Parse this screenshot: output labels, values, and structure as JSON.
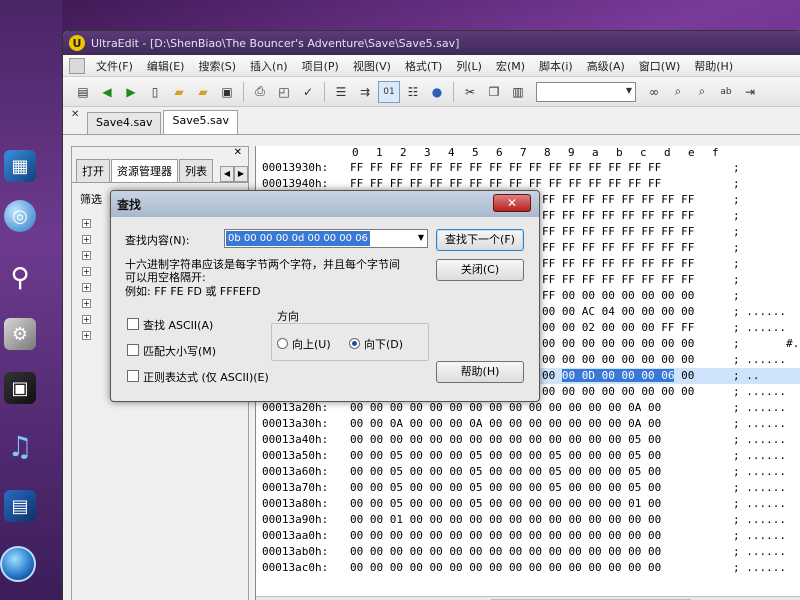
{
  "window": {
    "title": "UltraEdit - [D:\\ShenBiao\\The Bouncer's Adventure\\Save\\Save5.sav]",
    "app_icon_glyph": "U"
  },
  "menu": {
    "items": [
      "文件(F)",
      "编辑(E)",
      "搜索(S)",
      "插入(n)",
      "项目(P)",
      "视图(V)",
      "格式(T)",
      "列(L)",
      "宏(M)",
      "脚本(i)",
      "高级(A)",
      "窗口(W)",
      "帮助(H)"
    ]
  },
  "toolbar": {
    "buttons": [
      "new-document-icon",
      "arrow-back-icon",
      "arrow-forward-icon",
      "blank-page-icon",
      "open-folder-icon",
      "open-folder-2-icon",
      "save-icon",
      "print-icon",
      "print-preview-icon",
      "spell-check-icon",
      "wrap-icon",
      "indent-icon",
      "hex-mode-icon",
      "document-icon",
      "browser-icon",
      "cut-icon",
      "copy-icon",
      "paste-icon",
      "find-binoculars-icon",
      "find-next-icon",
      "find-prev-icon",
      "replace-icon",
      "goto-icon"
    ],
    "combo_value": ""
  },
  "tabs": [
    {
      "label": "Save4.sav",
      "active": false
    },
    {
      "label": "Save5.sav",
      "active": true
    }
  ],
  "left_panel": {
    "tabs": [
      "打开",
      "资源管理器",
      "列表"
    ],
    "active_tab": 1,
    "filter_label": "筛选"
  },
  "hex": {
    "header": [
      "0",
      "1",
      "2",
      "3",
      "4",
      "5",
      "6",
      "7",
      "8",
      "9",
      "a",
      "b",
      "c",
      "d",
      "e",
      "f"
    ],
    "rows": [
      {
        "addr": "00013930h:",
        "bytes": "FF FF FF FF FF FF FF FF FF FF FF FF FF FF FF FF",
        "ascii": "; "
      },
      {
        "addr": "00013940h:",
        "bytes": "FF FF FF FF FF FF FF FF FF FF FF FF FF FF FF FF",
        "ascii": "; "
      },
      {
        "addr": "",
        "bytes": "FF FF FF FF FF FF FF FF",
        "ascii": "; "
      },
      {
        "addr": "",
        "bytes": "FF FF FF FF FF FF FF FF",
        "ascii": "; "
      },
      {
        "addr": "",
        "bytes": "FF FF FF FF FF FF FF FF",
        "ascii": "; "
      },
      {
        "addr": "",
        "bytes": "FF FF FF FF FF FF FF FF",
        "ascii": "; "
      },
      {
        "addr": "",
        "bytes": "FF FF FF FF FF FF FF FF",
        "ascii": "; "
      },
      {
        "addr": "",
        "bytes": "FF FF FF FF FF FF FF FF",
        "ascii": "; "
      },
      {
        "addr": "",
        "bytes": "FF 00 00 00 00 00 00 00",
        "ascii": "; "
      },
      {
        "addr": "",
        "bytes": "00 00 AC 04 00 00 00 00",
        "ascii": "; ......"
      },
      {
        "addr": "",
        "bytes": "00 00 02 00 00 00 FF FF",
        "ascii": "; ......"
      },
      {
        "addr": "",
        "bytes": "00 00 00 00 00 00 00 00",
        "ascii": ";       #."
      },
      {
        "addr": "",
        "bytes": "00 00 00 00 00 00 00 00",
        "ascii": "; ......"
      },
      {
        "addr": "",
        "bytes": "00 00 0D 00 00 00 06 00",
        "ascii": "; .."
      },
      {
        "addr": "",
        "bytes": "00 00 00 00 00 00 00 00",
        "ascii": "; ......"
      },
      {
        "addr": "00013a20h:",
        "bytes": "00 00 00 00 00 00 00 00 00 00 00 00 00 00 0A 00",
        "ascii": "; ......"
      },
      {
        "addr": "00013a30h:",
        "bytes": "00 00 0A 00 00 00 0A 00 00 00 00 00 00 00 0A 00",
        "ascii": "; ......"
      },
      {
        "addr": "00013a40h:",
        "bytes": "00 00 00 00 00 00 00 00 00 00 00 00 00 00 05 00",
        "ascii": "; ......"
      },
      {
        "addr": "00013a50h:",
        "bytes": "00 00 05 00 00 00 05 00 00 00 05 00 00 00 05 00",
        "ascii": "; ......"
      },
      {
        "addr": "00013a60h:",
        "bytes": "00 00 05 00 00 00 05 00 00 00 05 00 00 00 05 00",
        "ascii": "; ......"
      },
      {
        "addr": "00013a70h:",
        "bytes": "00 00 05 00 00 00 05 00 00 00 05 00 00 00 05 00",
        "ascii": "; ......"
      },
      {
        "addr": "00013a80h:",
        "bytes": "00 00 05 00 00 00 05 00 00 00 00 00 00 00 01 00",
        "ascii": "; ......"
      },
      {
        "addr": "00013a90h:",
        "bytes": "00 00 01 00 00 00 00 00 00 00 00 00 00 00 00 00",
        "ascii": "; ......"
      },
      {
        "addr": "00013aa0h:",
        "bytes": "00 00 00 00 00 00 00 00 00 00 00 00 00 00 00 00",
        "ascii": "; ......"
      },
      {
        "addr": "00013ab0h:",
        "bytes": "00 00 00 00 00 00 00 00 00 00 00 00 00 00 00 00",
        "ascii": "; ......"
      },
      {
        "addr": "00013ac0h:",
        "bytes": "00 00 00 00 00 00 00 00 00 00 00 00 00 00 00 00",
        "ascii": "; ......"
      }
    ],
    "selected_row_index": 13,
    "selected_bytes": "00 0D 00 00 00 06"
  },
  "dialog": {
    "title": "查找",
    "find_label": "查找内容(N):",
    "find_value": "0b 00 00 00 0d 00 00 00 06",
    "hint_line1": "十六进制字符串应该是每字节两个字符，并且每个字节间",
    "hint_line2": "可以用空格隔开:",
    "hint_example": "例如: FF FE FD 或 FFFEFD",
    "find_next_label": "查找下一个(F)",
    "close_label": "关闭(C)",
    "help_label": "帮助(H)",
    "direction_label": "方向",
    "up_label": "向上(U)",
    "down_label": "向下(D)",
    "direction_value": "down",
    "find_ascii_label": "查找 ASCII(A)",
    "match_case_label": "匹配大小写(M)",
    "regex_label": "正则表达式 (仅 ASCII)(E)",
    "find_ascii_checked": false,
    "match_case_checked": false,
    "regex_checked": false
  }
}
